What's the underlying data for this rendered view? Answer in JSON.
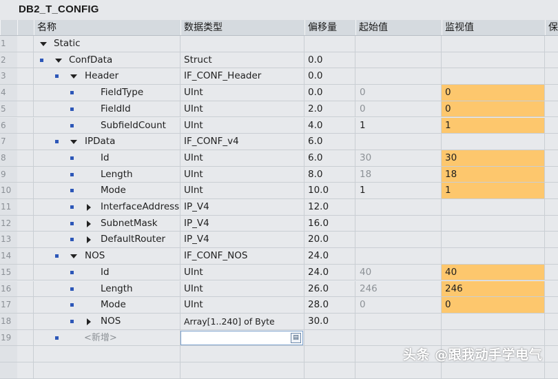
{
  "title": "DB2_T_CONFIG",
  "columns": [
    "名称",
    "数据类型",
    "偏移量",
    "起始值",
    "监视值",
    "保"
  ],
  "rows": [
    {
      "num": "1",
      "level": 0,
      "bullet": false,
      "expander": "down",
      "name": "Static",
      "type": "",
      "offset": "",
      "start": "",
      "start_dim": false,
      "monitor": "",
      "mon_hl": false
    },
    {
      "num": "2",
      "level": 1,
      "bullet": true,
      "expander": "down",
      "name": "ConfData",
      "type": "Struct",
      "offset": "0.0",
      "start": "",
      "start_dim": false,
      "monitor": "",
      "mon_hl": false
    },
    {
      "num": "3",
      "level": 2,
      "bullet": true,
      "expander": "down",
      "name": "Header",
      "type": "IF_CONF_Header",
      "offset": "0.0",
      "start": "",
      "start_dim": false,
      "monitor": "",
      "mon_hl": false
    },
    {
      "num": "4",
      "level": 3,
      "bullet": true,
      "expander": "none",
      "name": "FieldType",
      "type": "UInt",
      "offset": "0.0",
      "start": "0",
      "start_dim": true,
      "monitor": "0",
      "mon_hl": true
    },
    {
      "num": "5",
      "level": 3,
      "bullet": true,
      "expander": "none",
      "name": "FieldId",
      "type": "UInt",
      "offset": "2.0",
      "start": "0",
      "start_dim": true,
      "monitor": "0",
      "mon_hl": true
    },
    {
      "num": "6",
      "level": 3,
      "bullet": true,
      "expander": "none",
      "name": "SubfieldCount",
      "type": "UInt",
      "offset": "4.0",
      "start": "1",
      "start_dim": false,
      "monitor": "1",
      "mon_hl": true
    },
    {
      "num": "7",
      "level": 2,
      "bullet": true,
      "expander": "down",
      "name": "IPData",
      "type": "IF_CONF_v4",
      "offset": "6.0",
      "start": "",
      "start_dim": false,
      "monitor": "",
      "mon_hl": false
    },
    {
      "num": "8",
      "level": 3,
      "bullet": true,
      "expander": "none",
      "name": "Id",
      "type": "UInt",
      "offset": "6.0",
      "start": "30",
      "start_dim": true,
      "monitor": "30",
      "mon_hl": true
    },
    {
      "num": "9",
      "level": 3,
      "bullet": true,
      "expander": "none",
      "name": "Length",
      "type": "UInt",
      "offset": "8.0",
      "start": "18",
      "start_dim": true,
      "monitor": "18",
      "mon_hl": true
    },
    {
      "num": "10",
      "level": 3,
      "bullet": true,
      "expander": "none",
      "name": "Mode",
      "type": "UInt",
      "offset": "10.0",
      "start": "1",
      "start_dim": false,
      "monitor": "1",
      "mon_hl": true
    },
    {
      "num": "11",
      "level": 3,
      "bullet": true,
      "expander": "right",
      "name": "InterfaceAddress",
      "type": "IP_V4",
      "offset": "12.0",
      "start": "",
      "start_dim": false,
      "monitor": "",
      "mon_hl": false
    },
    {
      "num": "12",
      "level": 3,
      "bullet": true,
      "expander": "right",
      "name": "SubnetMask",
      "type": "IP_V4",
      "offset": "16.0",
      "start": "",
      "start_dim": false,
      "monitor": "",
      "mon_hl": false
    },
    {
      "num": "13",
      "level": 3,
      "bullet": true,
      "expander": "right",
      "name": "DefaultRouter",
      "type": "IP_V4",
      "offset": "20.0",
      "start": "",
      "start_dim": false,
      "monitor": "",
      "mon_hl": false
    },
    {
      "num": "14",
      "level": 2,
      "bullet": true,
      "expander": "down",
      "name": "NOS",
      "type": "IF_CONF_NOS",
      "offset": "24.0",
      "start": "",
      "start_dim": false,
      "monitor": "",
      "mon_hl": false
    },
    {
      "num": "15",
      "level": 3,
      "bullet": true,
      "expander": "none",
      "name": "Id",
      "type": "UInt",
      "offset": "24.0",
      "start": "40",
      "start_dim": true,
      "monitor": "40",
      "mon_hl": true
    },
    {
      "num": "16",
      "level": 3,
      "bullet": true,
      "expander": "none",
      "name": "Length",
      "type": "UInt",
      "offset": "26.0",
      "start": "246",
      "start_dim": true,
      "monitor": "246",
      "mon_hl": true
    },
    {
      "num": "17",
      "level": 3,
      "bullet": true,
      "expander": "none",
      "name": "Mode",
      "type": "UInt",
      "offset": "28.0",
      "start": "0",
      "start_dim": true,
      "monitor": "0",
      "mon_hl": true
    },
    {
      "num": "18",
      "level": 3,
      "bullet": true,
      "expander": "right",
      "name": "NOS",
      "type": "Array[1..240] of Byte",
      "offset": "30.0",
      "start": "",
      "start_dim": false,
      "monitor": "",
      "mon_hl": false
    }
  ],
  "add_row": {
    "num": "19",
    "label": "<新增>"
  },
  "watermark": "头条 @跟我动手学电气",
  "colors": {
    "highlight": "#fdc76d",
    "header_bg": "#d5dadf",
    "row_bg": "#e7e9ec",
    "bullet": "#2d57b8"
  },
  "icons": {
    "db_row": "db-interface-icon",
    "bullet": "member-bullet-icon",
    "expand": "expand-triangle-icon",
    "select": "type-select-icon"
  }
}
